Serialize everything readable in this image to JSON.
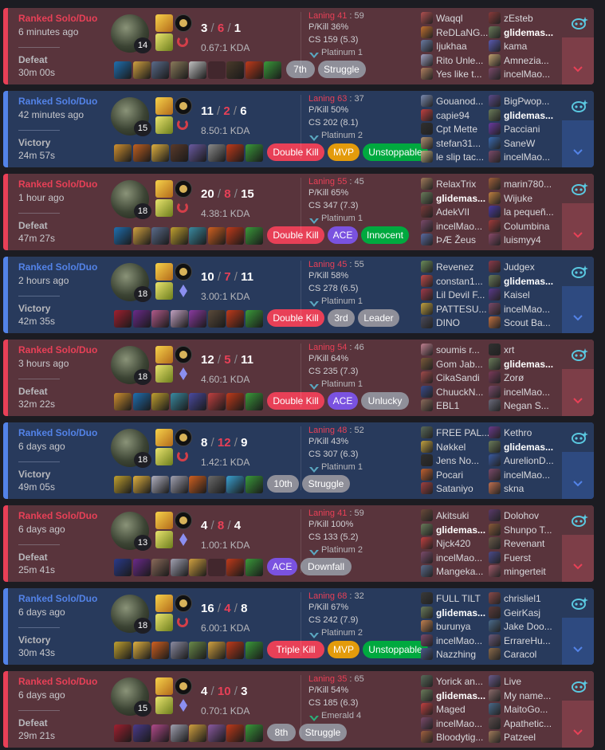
{
  "matches": [
    {
      "outcome": "loss",
      "queue": "Ranked Solo/Duo",
      "ago": "6 minutes ago",
      "result": "Defeat",
      "duration": "30m 00s",
      "level": "14",
      "kills": "3",
      "deaths": "6",
      "assists": "1",
      "kda": "0.67:1 KDA",
      "laning_label": "Laning 41",
      "laning_opp": " : 59",
      "pkill": "P/Kill 36%",
      "cs": "CS 159 (5.3)",
      "rank": "Platinum 1",
      "rank_icon": "platinum-icon",
      "rune2": "red",
      "items": [
        "#1f6fb0",
        "#d0a040",
        "#5a6b8a",
        "#8a7a5a",
        "#c0c0c0",
        "empty",
        "#4a3a2a",
        "#c03a1a",
        "#3a9a3a"
      ],
      "badges": [
        {
          "text": "7th",
          "color": "gray"
        },
        {
          "text": "Struggle",
          "color": "gray"
        }
      ],
      "team1": [
        {
          "name": "Waqql",
          "me": false,
          "pic": "#b05050"
        },
        {
          "name": "ReDLaNG...",
          "me": false,
          "pic": "#c07030"
        },
        {
          "name": "Ijukhaa",
          "me": false,
          "pic": "#6a7aa0"
        },
        {
          "name": "Rito Unle...",
          "me": false,
          "pic": "#a0a0c0"
        },
        {
          "name": "Yes like t...",
          "me": false,
          "pic": "#b08060"
        }
      ],
      "team2": [
        {
          "name": "zEsteb",
          "me": false,
          "pic": "#8a3a3a"
        },
        {
          "name": "glidemas...",
          "me": true,
          "pic": "#6a7a5a"
        },
        {
          "name": "kama",
          "me": false,
          "pic": "#5a5ab0"
        },
        {
          "name": "Amnezia...",
          "me": false,
          "pic": "#c0a070"
        },
        {
          "name": "incelMao...",
          "me": false,
          "pic": "#7a4a6a"
        }
      ]
    },
    {
      "outcome": "win",
      "queue": "Ranked Solo/Duo",
      "ago": "42 minutes ago",
      "result": "Victory",
      "duration": "24m 57s",
      "level": "15",
      "kills": "11",
      "deaths": "2",
      "assists": "6",
      "kda": "8.50:1 KDA",
      "laning_label": "Laning 63",
      "laning_opp": " : 37",
      "pkill": "P/Kill 50%",
      "cs": "CS 202 (8.1)",
      "rank": "Platinum 2",
      "rank_icon": "platinum-icon",
      "rune2": "red",
      "items": [
        "#d09030",
        "#c06020",
        "#e0b040",
        "#5a3a2a",
        "#6a5aa0",
        "#8a8a8a",
        "#c03a1a",
        "#3a9a3a"
      ],
      "badges": [
        {
          "text": "Double Kill",
          "color": "red"
        },
        {
          "text": "MVP",
          "color": "gold"
        },
        {
          "text": "Unstoppable",
          "color": "green"
        }
      ],
      "team1": [
        {
          "name": "Gouanod...",
          "me": false,
          "pic": "#7a8ab0"
        },
        {
          "name": "capie94",
          "me": false,
          "pic": "#c04040"
        },
        {
          "name": "Cpt Mette",
          "me": false,
          "pic": "#303030"
        },
        {
          "name": "stefan31...",
          "me": false,
          "pic": "#b09070"
        },
        {
          "name": "le slip tac...",
          "me": false,
          "pic": "#c0b080"
        }
      ],
      "team2": [
        {
          "name": "BigPwop...",
          "me": false,
          "pic": "#5a4a8a"
        },
        {
          "name": "glidemas...",
          "me": true,
          "pic": "#6a7a5a"
        },
        {
          "name": "Pacciani",
          "me": false,
          "pic": "#6a3aa0"
        },
        {
          "name": "SaneW",
          "me": false,
          "pic": "#3a6ab0"
        },
        {
          "name": "incelMao...",
          "me": false,
          "pic": "#7a4a6a"
        }
      ]
    },
    {
      "outcome": "loss",
      "queue": "Ranked Solo/Duo",
      "ago": "1 hour ago",
      "result": "Defeat",
      "duration": "47m 27s",
      "level": "18",
      "kills": "20",
      "deaths": "8",
      "assists": "15",
      "kda": "4.38:1 KDA",
      "laning_label": "Laning 55",
      "laning_opp": " : 45",
      "pkill": "P/Kill 65%",
      "cs": "CS 347 (7.3)",
      "rank": "Platinum 1",
      "rank_icon": "platinum-icon",
      "rune2": "red",
      "items": [
        "#1f6fb0",
        "#d0a040",
        "#5a6b8a",
        "#c0a030",
        "#3a8aa0",
        "#d06020",
        "#c03a1a",
        "#3a9a3a"
      ],
      "badges": [
        {
          "text": "Double Kill",
          "color": "red"
        },
        {
          "text": "ACE",
          "color": "purple"
        },
        {
          "text": "Innocent",
          "color": "green"
        }
      ],
      "team1": [
        {
          "name": "RelaxTrix",
          "me": false,
          "pic": "#a07a5a"
        },
        {
          "name": "glidemas...",
          "me": true,
          "pic": "#6a7a5a"
        },
        {
          "name": "AdekVII",
          "me": false,
          "pic": "#7a3a3a"
        },
        {
          "name": "incelMao...",
          "me": false,
          "pic": "#7a4a6a"
        },
        {
          "name": "ÞÆ Žeus",
          "me": false,
          "pic": "#5a6aa0"
        }
      ],
      "team2": [
        {
          "name": "marin780...",
          "me": false,
          "pic": "#a0603a"
        },
        {
          "name": "Wijuke",
          "me": false,
          "pic": "#c08040"
        },
        {
          "name": "la pequeñ...",
          "me": false,
          "pic": "#4a3aa0"
        },
        {
          "name": "Columbina",
          "me": false,
          "pic": "#a03a3a"
        },
        {
          "name": "luismyy4",
          "me": false,
          "pic": "#8a4a6a"
        }
      ]
    },
    {
      "outcome": "win",
      "queue": "Ranked Solo/Duo",
      "ago": "2 hours ago",
      "result": "Victory",
      "duration": "42m 35s",
      "level": "18",
      "kills": "10",
      "deaths": "7",
      "assists": "11",
      "kda": "3.00:1 KDA",
      "laning_label": "Laning 45",
      "laning_opp": " : 55",
      "pkill": "P/Kill 58%",
      "cs": "CS 278 (6.5)",
      "rank": "Platinum 1",
      "rank_icon": "platinum-icon",
      "rune2": "blue",
      "items": [
        "#a02030",
        "#6a2a8a",
        "#b05a8a",
        "#c0a0c0",
        "#8a3aa0",
        "#5a4a3a",
        "#c03a1a",
        "#3a9a3a"
      ],
      "badges": [
        {
          "text": "Double Kill",
          "color": "red"
        },
        {
          "text": "3rd",
          "color": "gray"
        },
        {
          "text": "Leader",
          "color": "gray"
        }
      ],
      "team1": [
        {
          "name": "Revenez",
          "me": false,
          "pic": "#6a8a5a"
        },
        {
          "name": "constan1...",
          "me": false,
          "pic": "#c04a4a"
        },
        {
          "name": "Lil Devil F...",
          "me": false,
          "pic": "#a03a4a"
        },
        {
          "name": "PATTESU...",
          "me": false,
          "pic": "#c0a040"
        },
        {
          "name": "DINO",
          "me": false,
          "pic": "#4a4a5a"
        }
      ],
      "team2": [
        {
          "name": "Judgex",
          "me": false,
          "pic": "#8a3a4a"
        },
        {
          "name": "glidemas...",
          "me": true,
          "pic": "#6a7a5a"
        },
        {
          "name": "Kaisel",
          "me": false,
          "pic": "#5a3a8a"
        },
        {
          "name": "incelMao...",
          "me": false,
          "pic": "#7a4a6a"
        },
        {
          "name": "Scout Ba...",
          "me": false,
          "pic": "#c07040"
        }
      ]
    },
    {
      "outcome": "loss",
      "queue": "Ranked Solo/Duo",
      "ago": "3 hours ago",
      "result": "Defeat",
      "duration": "32m 22s",
      "level": "18",
      "kills": "12",
      "deaths": "5",
      "assists": "11",
      "kda": "4.60:1 KDA",
      "laning_label": "Laning 54",
      "laning_opp": " : 46",
      "pkill": "P/Kill 64%",
      "cs": "CS 235 (7.3)",
      "rank": "Platinum 1",
      "rank_icon": "platinum-icon",
      "rune2": "blue",
      "items": [
        "#d09030",
        "#1f6fb0",
        "#c0a030",
        "#3a8aa0",
        "#4a4aa0",
        "#c04040",
        "#c03a1a",
        "#3a9a3a"
      ],
      "badges": [
        {
          "text": "Double Kill",
          "color": "red"
        },
        {
          "text": "ACE",
          "color": "purple"
        },
        {
          "text": "Unlucky",
          "color": "gray"
        }
      ],
      "team1": [
        {
          "name": "soumis r...",
          "me": false,
          "pic": "#c08090"
        },
        {
          "name": "Gom Jab...",
          "me": false,
          "pic": "#7a5a3a"
        },
        {
          "name": "CikaSandi",
          "me": false,
          "pic": "#a04a4a"
        },
        {
          "name": "ChuuckN...",
          "me": false,
          "pic": "#3a4a8a"
        },
        {
          "name": "EBL1",
          "me": false,
          "pic": "#8a6a5a"
        }
      ],
      "team2": [
        {
          "name": "xrt",
          "me": false,
          "pic": "#303030"
        },
        {
          "name": "glidemas...",
          "me": true,
          "pic": "#6a7a5a"
        },
        {
          "name": "Zorø",
          "me": false,
          "pic": "#7a3a5a"
        },
        {
          "name": "incelMao...",
          "me": false,
          "pic": "#7a4a6a"
        },
        {
          "name": "Negan S...",
          "me": false,
          "pic": "#6a6a7a"
        }
      ]
    },
    {
      "outcome": "win",
      "queue": "Ranked Solo/Duo",
      "ago": "6 days ago",
      "result": "Victory",
      "duration": "49m 05s",
      "level": "18",
      "kills": "8",
      "deaths": "12",
      "assists": "9",
      "kda": "1.42:1 KDA",
      "laning_label": "Laning 48",
      "laning_opp": " : 52",
      "pkill": "P/Kill 43%",
      "cs": "CS 307 (6.3)",
      "rank": "Platinum 1",
      "rank_icon": "platinum-icon",
      "rune2": "red",
      "items": [
        "#c0a030",
        "#e0b040",
        "#b0b0c0",
        "#a0a0b0",
        "#d06020",
        "#6a6a6a",
        "#3aa0d0",
        "#3a9a3a"
      ],
      "badges": [
        {
          "text": "10th",
          "color": "gray"
        },
        {
          "text": "Struggle",
          "color": "gray"
        }
      ],
      "team1": [
        {
          "name": "FREE PAL...",
          "me": false,
          "pic": "#5a6a5a"
        },
        {
          "name": "Nøkkel",
          "me": false,
          "pic": "#c0a040"
        },
        {
          "name": "Jens No...",
          "me": false,
          "pic": "#303030"
        },
        {
          "name": "Pocari",
          "me": false,
          "pic": "#c06030"
        },
        {
          "name": "Sataniyo",
          "me": false,
          "pic": "#a04040"
        }
      ],
      "team2": [
        {
          "name": "Kethro",
          "me": false,
          "pic": "#6a3a8a"
        },
        {
          "name": "glidemas...",
          "me": true,
          "pic": "#6a7a5a"
        },
        {
          "name": "AurelionD...",
          "me": false,
          "pic": "#3a5aa0"
        },
        {
          "name": "incelMao...",
          "me": false,
          "pic": "#7a4a6a"
        },
        {
          "name": "skna",
          "me": false,
          "pic": "#c07050"
        }
      ]
    },
    {
      "outcome": "loss",
      "queue": "Ranked Solo/Duo",
      "ago": "6 days ago",
      "result": "Defeat",
      "duration": "25m 41s",
      "level": "13",
      "kills": "4",
      "deaths": "8",
      "assists": "4",
      "kda": "1.00:1 KDA",
      "laning_label": "Laning 41",
      "laning_opp": " : 59",
      "pkill": "P/Kill 100%",
      "cs": "CS 133 (5.2)",
      "rank": "Platinum 2",
      "rank_icon": "platinum-icon",
      "rune2": "blue",
      "items": [
        "#2a3a8a",
        "#6a2a8a",
        "#8a6a5a",
        "#a0a0b0",
        "#d0a040",
        "empty",
        "#c03a1a",
        "#3a9a3a"
      ],
      "badges": [
        {
          "text": "ACE",
          "color": "purple"
        },
        {
          "text": "Downfall",
          "color": "gray"
        }
      ],
      "team1": [
        {
          "name": "Akitsuki",
          "me": false,
          "pic": "#6a4a3a"
        },
        {
          "name": "glidemas...",
          "me": true,
          "pic": "#6a7a5a"
        },
        {
          "name": "Njck420",
          "me": false,
          "pic": "#c04040"
        },
        {
          "name": "incelMao...",
          "me": false,
          "pic": "#7a4a6a"
        },
        {
          "name": "Mangeka...",
          "me": false,
          "pic": "#5a6a8a"
        }
      ],
      "team2": [
        {
          "name": "Dolohov",
          "me": false,
          "pic": "#5a3a6a"
        },
        {
          "name": "Shunpo T...",
          "me": false,
          "pic": "#8a5a3a"
        },
        {
          "name": "Revenant",
          "me": false,
          "pic": "#6a5a4a"
        },
        {
          "name": "Fuerst",
          "me": false,
          "pic": "#4a4a8a"
        },
        {
          "name": "mingerteit",
          "me": false,
          "pic": "#a05a6a"
        }
      ]
    },
    {
      "outcome": "win",
      "queue": "Ranked Solo/Duo",
      "ago": "6 days ago",
      "result": "Victory",
      "duration": "30m 43s",
      "level": "18",
      "kills": "16",
      "deaths": "4",
      "assists": "8",
      "kda": "6.00:1 KDA",
      "laning_label": "Laning 68",
      "laning_opp": " : 32",
      "pkill": "P/Kill 67%",
      "cs": "CS 242 (7.9)",
      "rank": "Platinum 2",
      "rank_icon": "platinum-icon",
      "rune2": "red",
      "items": [
        "#c0a030",
        "#e0b040",
        "#d06020",
        "#8a8aa0",
        "#6a8a4a",
        "#d0a040",
        "#c03a1a",
        "#3a9a3a"
      ],
      "badges": [
        {
          "text": "Triple Kill",
          "color": "red"
        },
        {
          "text": "MVP",
          "color": "gold"
        },
        {
          "text": "Unstoppable",
          "color": "green"
        }
      ],
      "team1": [
        {
          "name": "FULL TILT",
          "me": false,
          "pic": "#3a3a3a"
        },
        {
          "name": "glidemas...",
          "me": true,
          "pic": "#6a7a5a"
        },
        {
          "name": "burunya",
          "me": false,
          "pic": "#c08050"
        },
        {
          "name": "incelMao...",
          "me": false,
          "pic": "#7a4a6a"
        },
        {
          "name": "Nazzhing",
          "me": false,
          "pic": "#4a5a8a"
        }
      ],
      "team2": [
        {
          "name": "chrisliel1",
          "me": false,
          "pic": "#8a4a4a"
        },
        {
          "name": "GeirKasj",
          "me": false,
          "pic": "#5a3a3a"
        },
        {
          "name": "Jake Doo...",
          "me": false,
          "pic": "#4a6a8a"
        },
        {
          "name": "ErrareHu...",
          "me": false,
          "pic": "#6a5a7a"
        },
        {
          "name": "Caracol",
          "me": false,
          "pic": "#8a6a4a"
        }
      ]
    },
    {
      "outcome": "loss",
      "queue": "Ranked Solo/Duo",
      "ago": "6 days ago",
      "result": "Defeat",
      "duration": "29m 21s",
      "level": "15",
      "kills": "4",
      "deaths": "10",
      "assists": "3",
      "kda": "0.70:1 KDA",
      "laning_label": "Laning 35",
      "laning_opp": " : 65",
      "pkill": "P/Kill 54%",
      "cs": "CS 185 (6.3)",
      "rank": "Emerald 4",
      "rank_icon": "emerald-icon",
      "rune2": "blue",
      "items": [
        "#a02030",
        "#4a3a8a",
        "#b04a8a",
        "#a0a0b0",
        "#d0a040",
        "#8a5aa0",
        "#c03a1a",
        "#3a9a3a"
      ],
      "badges": [
        {
          "text": "8th",
          "color": "gray"
        },
        {
          "text": "Struggle",
          "color": "gray"
        }
      ],
      "team1": [
        {
          "name": "Yorick an...",
          "me": false,
          "pic": "#5a6a5a"
        },
        {
          "name": "glidemas...",
          "me": true,
          "pic": "#6a7a5a"
        },
        {
          "name": "Maged",
          "me": false,
          "pic": "#c04040"
        },
        {
          "name": "incelMao...",
          "me": false,
          "pic": "#7a4a6a"
        },
        {
          "name": "Bloodytig...",
          "me": false,
          "pic": "#a06040"
        }
      ],
      "team2": [
        {
          "name": "Live",
          "me": false,
          "pic": "#6a5a8a"
        },
        {
          "name": "My name...",
          "me": false,
          "pic": "#8a6a6a"
        },
        {
          "name": "MaitoGo...",
          "me": false,
          "pic": "#4a6a8a"
        },
        {
          "name": "Apathetic...",
          "me": false,
          "pic": "#5a4a4a"
        },
        {
          "name": "Patzeel",
          "me": false,
          "pic": "#a07a5a"
        }
      ]
    }
  ]
}
